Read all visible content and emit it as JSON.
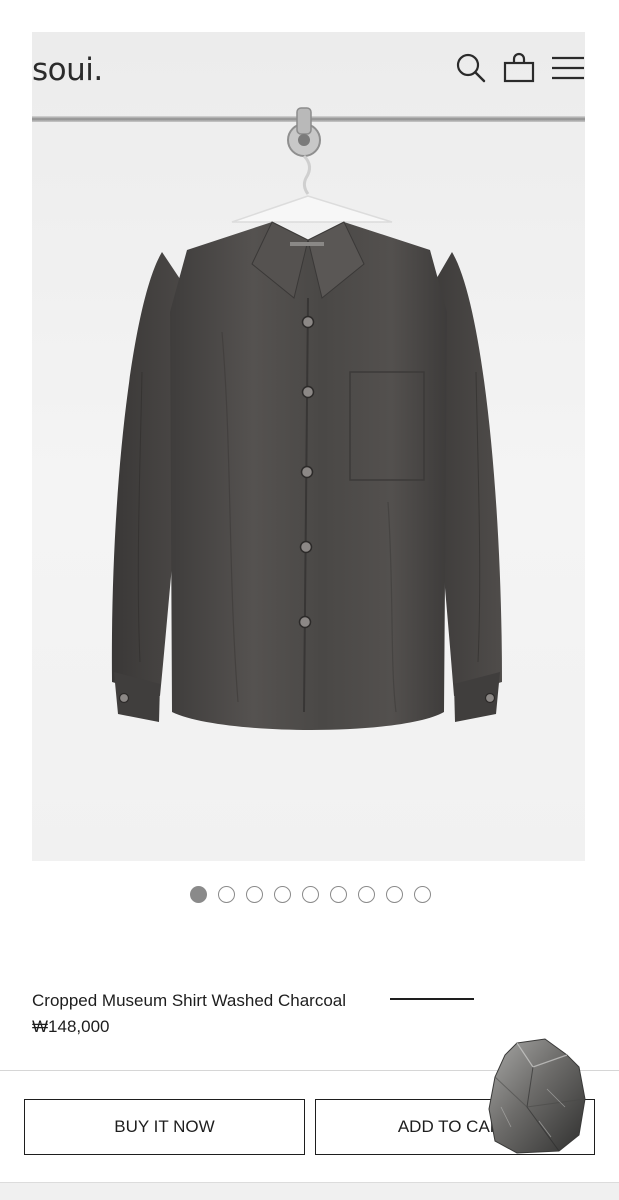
{
  "header": {
    "logo": "soui.",
    "icons": [
      "search-icon",
      "shopping-bag-icon",
      "menu-icon"
    ]
  },
  "gallery": {
    "slide_count": 9,
    "active_index": 0
  },
  "product": {
    "name": "Cropped Museum Shirt Washed Charcoal",
    "price": "₩148,000"
  },
  "actions": {
    "buy_now": "BUY IT NOW",
    "add_to_cart": "ADD TO CART"
  },
  "colors": {
    "shirt": "#4a4846",
    "background": "#f1f1f1",
    "text": "#1e1e1e"
  }
}
